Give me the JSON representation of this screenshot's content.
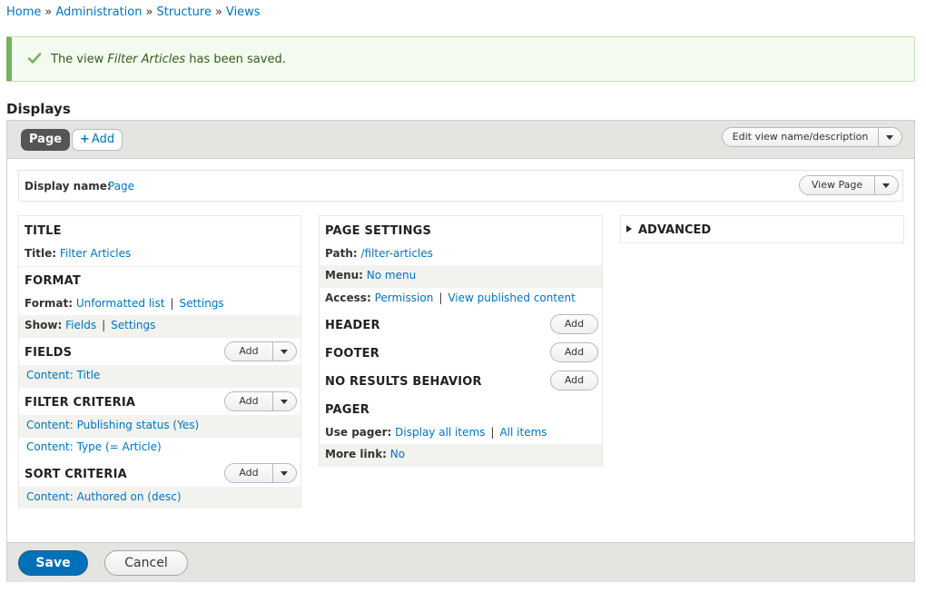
{
  "breadcrumb": [
    "Home",
    "Administration",
    "Structure",
    "Views"
  ],
  "breadcrumb_sep": "»",
  "message": {
    "prefix": "The view ",
    "view_name": "Filter Articles",
    "suffix": " has been saved."
  },
  "displays_title": "Displays",
  "tabs": {
    "page": "Page",
    "add": "Add",
    "add_icon": "plus-icon"
  },
  "edit_view_button": "Edit view name/description",
  "display_name": {
    "label": "Display name:",
    "value": "Page",
    "view_page_button": "View Page"
  },
  "col1": {
    "title": {
      "heading": "TITLE",
      "label": "Title:",
      "value": "Filter Articles"
    },
    "format": {
      "heading": "FORMAT",
      "format_label": "Format:",
      "format_value": "Unformatted list",
      "format_settings": "Settings",
      "show_label": "Show:",
      "show_value": "Fields",
      "show_settings": "Settings"
    },
    "fields": {
      "heading": "FIELDS",
      "add": "Add",
      "items": [
        "Content: Title"
      ]
    },
    "filter": {
      "heading": "FILTER CRITERIA",
      "add": "Add",
      "items": [
        "Content: Publishing status (Yes)",
        "Content: Type (= Article)"
      ]
    },
    "sort": {
      "heading": "SORT CRITERIA",
      "add": "Add",
      "items": [
        "Content: Authored on (desc)"
      ]
    }
  },
  "col2": {
    "page_settings": {
      "heading": "PAGE SETTINGS",
      "path_label": "Path:",
      "path_value": "/filter-articles",
      "menu_label": "Menu:",
      "menu_value": "No menu",
      "access_label": "Access:",
      "access_value": "Permission",
      "access_value2": "View published content"
    },
    "header": {
      "heading": "HEADER",
      "add": "Add"
    },
    "footer": {
      "heading": "FOOTER",
      "add": "Add"
    },
    "no_results": {
      "heading": "NO RESULTS BEHAVIOR",
      "add": "Add"
    },
    "pager": {
      "heading": "PAGER",
      "use_label": "Use pager:",
      "use_value": "Display all items",
      "use_value2": "All items",
      "more_label": "More link:",
      "more_value": "No"
    }
  },
  "col3": {
    "advanced": "ADVANCED"
  },
  "buttons": {
    "save": "Save",
    "cancel": "Cancel"
  },
  "colors": {
    "primary": "#0071b8",
    "link": "#0074bd",
    "success": "#77b259"
  }
}
